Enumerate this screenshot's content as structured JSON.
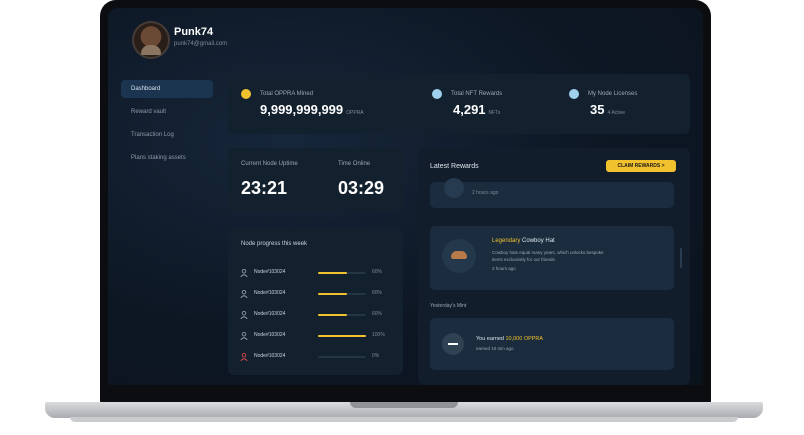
{
  "user": {
    "name": "Punk74",
    "email": "punk74@gmail.com"
  },
  "sidebar": {
    "items": [
      {
        "label": "Dashboard",
        "active": true
      },
      {
        "label": "Reward vault",
        "active": false
      },
      {
        "label": "Transaction Log",
        "active": false
      },
      {
        "label": "Plans staking assets",
        "active": false
      }
    ]
  },
  "stats": [
    {
      "label": "Total OPPRA Mined",
      "value": "9,999,999,999",
      "unit": "OPPRA",
      "dot_color": "#f2c12e"
    },
    {
      "label": "Total NFT Rewards",
      "value": "4,291",
      "unit": "NFTs",
      "dot_color": "#9fd0ee"
    },
    {
      "label": "My Node Licenses",
      "value": "35",
      "unit": "4 Active",
      "dot_color": "#9fd0ee"
    }
  ],
  "timers": {
    "uptime_label": "Current Node Uptime",
    "uptime_value": "23:21",
    "offline_label": "Time Online",
    "offline_value": "03:29"
  },
  "progress": {
    "title": "Node progress this week",
    "rows": [
      {
        "id": "Node#103024",
        "pct": 60,
        "pct_label": "60%",
        "status": "normal"
      },
      {
        "id": "Node#103024",
        "pct": 60,
        "pct_label": "60%",
        "status": "normal"
      },
      {
        "id": "Node#103024",
        "pct": 60,
        "pct_label": "60%",
        "status": "normal"
      },
      {
        "id": "Node#103024",
        "pct": 100,
        "pct_label": "100%",
        "status": "normal"
      },
      {
        "id": "Node#103024",
        "pct": 0,
        "pct_label": "0%",
        "status": "error"
      }
    ]
  },
  "rewards": {
    "title": "Latest Rewards",
    "button_label": "CLAIM REWARDS >",
    "top_partial_time": "2 hours ago",
    "featured": {
      "highlight": "Legendary",
      "name": "Cowboy Hat",
      "desc": "Cowboy hats equal many years, which unlocks bespoke items exclusively for our friends.",
      "time": "2 hours ago"
    },
    "yesterday_label": "Yesterday's Mint",
    "yesterday": {
      "prefix": "You earned",
      "highlight": "10,000 OPPRA",
      "time": "earned 10 min ago"
    }
  },
  "colors": {
    "accent": "#f2c12e",
    "card": "#13212f",
    "bg": "#0d1724"
  }
}
